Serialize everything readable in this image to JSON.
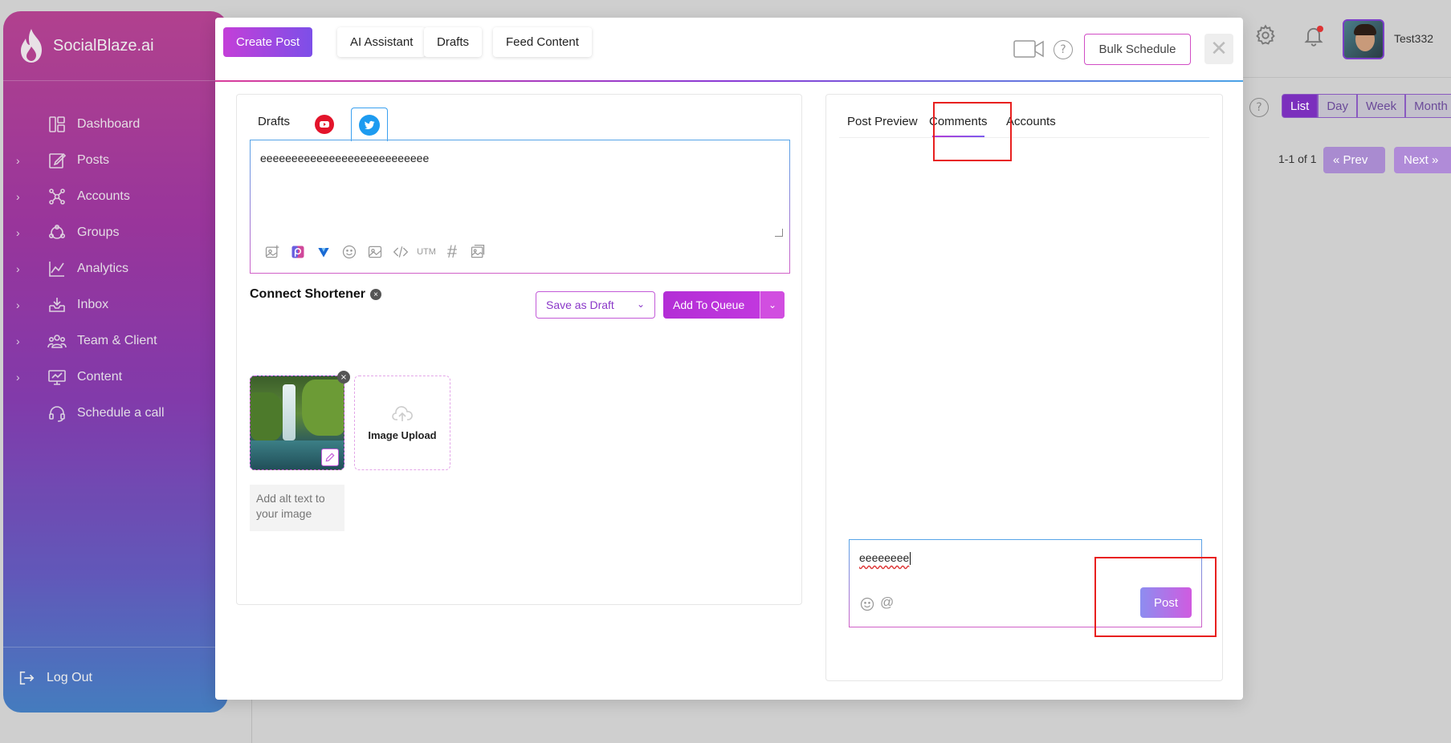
{
  "app": {
    "brand": "SocialBlaze.ai"
  },
  "sidebar": {
    "items": [
      {
        "label": "Dashboard",
        "icon": "dashboard-icon",
        "expandable": false
      },
      {
        "label": "Posts",
        "icon": "edit-icon",
        "expandable": true
      },
      {
        "label": "Accounts",
        "icon": "network-icon",
        "expandable": true
      },
      {
        "label": "Groups",
        "icon": "groups-icon",
        "expandable": true
      },
      {
        "label": "Analytics",
        "icon": "chart-line-icon",
        "expandable": true
      },
      {
        "label": "Inbox",
        "icon": "inbox-icon",
        "expandable": true
      },
      {
        "label": "Team & Client",
        "icon": "team-icon",
        "expandable": true
      },
      {
        "label": "Content",
        "icon": "monitor-icon",
        "expandable": true
      },
      {
        "label": "Schedule a call",
        "icon": "headset-icon",
        "expandable": false
      }
    ],
    "logout": "Log Out"
  },
  "topbar": {
    "username": "Test332"
  },
  "calendar": {
    "help": "?",
    "views": [
      "List",
      "Day",
      "Week",
      "Month"
    ],
    "active_view": "List",
    "pager_text": "1-1 of 1",
    "prev": "« Prev",
    "next": "Next »"
  },
  "modal": {
    "tabs": [
      "Create Post",
      "AI Assistant",
      "Drafts",
      "Feed Content"
    ],
    "active_tab": "Create Post",
    "help": "?",
    "bulk_schedule": "Bulk Schedule",
    "close": "✕",
    "editor": {
      "tab_drafts": "Drafts",
      "content": "eeeeeeeeeeeeeeeeeeeeeeeeeee",
      "toolbar": [
        "image-ai-icon",
        "picsart-icon",
        "vista-icon",
        "emoji-icon",
        "image-icon",
        "code-icon",
        "utm-icon",
        "hashtag-icon",
        "media-library-icon"
      ],
      "utm_label": "UTM",
      "hash_label": "#"
    },
    "shortener": {
      "label": "Connect Shortener",
      "close": "×"
    },
    "save_draft": "Save as Draft",
    "add_to_queue": "Add To Queue",
    "media": {
      "upload_label": "Image Upload",
      "alt_placeholder": "Add alt text to your image",
      "remove": "×"
    },
    "preview": {
      "tabs": [
        "Post Preview",
        "Comments",
        "Accounts"
      ],
      "active_tab": "Comments",
      "comment_value": "eeeeeeee",
      "at_symbol": "@",
      "post_button": "Post"
    }
  },
  "colors": {
    "accent": "#b32ed6",
    "twitter": "#1d9bf0",
    "youtube": "#ff0000",
    "highlight": "#e8201f"
  }
}
